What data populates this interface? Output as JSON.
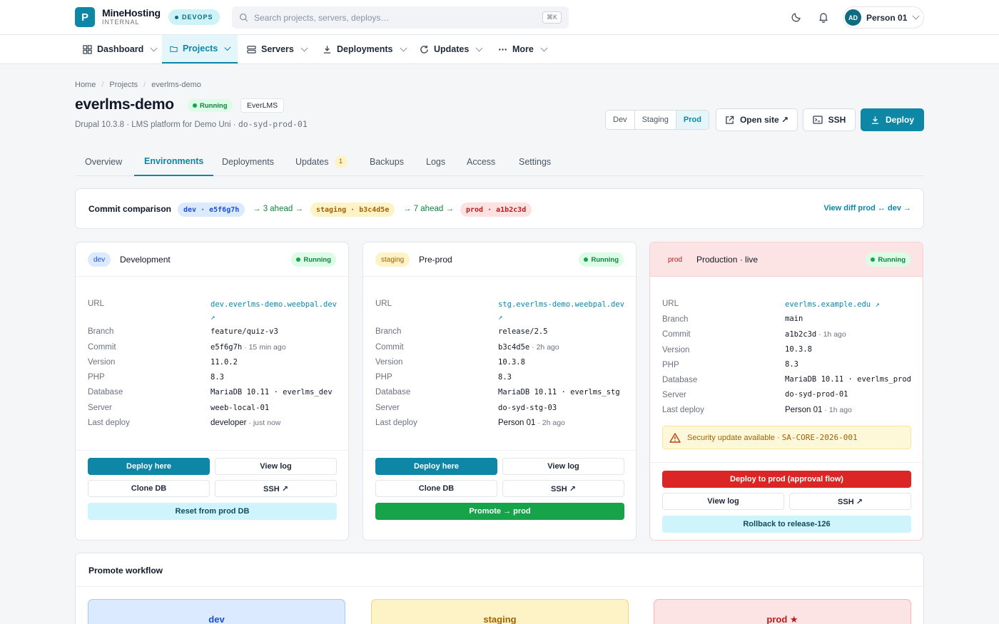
{
  "header": {
    "logo_letter": "P",
    "brand_name": "MineHosting",
    "brand_sub": "INTERNAL",
    "env_badge": "DEVOPS",
    "search_placeholder": "Search projects, servers, deploys…",
    "search_shortcut": "⌘K",
    "user_initials": "AD",
    "user_name": "Person 01"
  },
  "nav": {
    "items": [
      {
        "label": "Dashboard",
        "icon": "dashboard-icon"
      },
      {
        "label": "Projects",
        "icon": "folder-icon",
        "active": true
      },
      {
        "label": "Servers",
        "icon": "server-icon"
      },
      {
        "label": "Deployments",
        "icon": "download-icon"
      },
      {
        "label": "Updates",
        "icon": "refresh-icon"
      },
      {
        "label": "More",
        "icon": "more-icon"
      }
    ]
  },
  "breadcrumb": [
    "Home",
    "Projects",
    "everlms-demo"
  ],
  "project": {
    "title": "everlms-demo",
    "status": "Running",
    "tag": "EverLMS",
    "subtitle_plain": "Drupal 10.3.8 · LMS platform for Demo Uni · ",
    "subtitle_server": "do-syd-prod-01"
  },
  "env_switch": [
    "Dev",
    "Staging",
    "Prod"
  ],
  "actions": {
    "open_site": "Open site ↗",
    "ssh": "SSH",
    "deploy": "Deploy"
  },
  "tabs": [
    {
      "label": "Overview"
    },
    {
      "label": "Environments",
      "active": true
    },
    {
      "label": "Deployments"
    },
    {
      "label": "Updates",
      "badge": "1"
    },
    {
      "label": "Backups"
    },
    {
      "label": "Logs"
    },
    {
      "label": "Access"
    },
    {
      "label": "Settings"
    }
  ],
  "commit_comparison": {
    "title": "Commit comparison",
    "dev": "dev · e5f6g7h",
    "dev_to_staging": "→ 3 ahead →",
    "staging": "staging · b3c4d5e",
    "staging_to_prod": "→ 7 ahead →",
    "prod": "prod · a1b2c3d",
    "link": "View diff prod ↔ dev →"
  },
  "environments": {
    "dev": {
      "chip": "dev",
      "name": "Development",
      "status": "Running",
      "labels": [
        "URL",
        "Branch",
        "Commit",
        "Version",
        "PHP",
        "Database",
        "Server",
        "Last deploy"
      ],
      "url": "dev.everlms-demo.weebpal.dev ↗",
      "branch": "feature/quiz-v3",
      "commit": "e5f6g7h",
      "commit_age": " · 15 min ago",
      "version": "11.0.2",
      "php": "8.3",
      "database": "MariaDB 10.11 · everlms_dev",
      "server": "weeb-local-01",
      "last_deploy_by": "developer",
      "last_deploy_age": " · just now",
      "buttons": {
        "deploy": "Deploy here",
        "view_log": "View log",
        "clone_db": "Clone DB",
        "ssh": "SSH ↗",
        "reset": "Reset from prod DB"
      }
    },
    "staging": {
      "chip": "staging",
      "name": "Pre-prod",
      "status": "Running",
      "labels": [
        "URL",
        "Branch",
        "Commit",
        "Version",
        "PHP",
        "Database",
        "Server",
        "Last deploy"
      ],
      "url": "stg.everlms-demo.weebpal.dev ↗",
      "branch": "release/2.5",
      "commit": "b3c4d5e",
      "commit_age": " · 2h ago",
      "version": "10.3.8",
      "php": "8.3",
      "database": "MariaDB 10.11 · everlms_stg",
      "server": "do-syd-stg-03",
      "last_deploy_by": "Person 01",
      "last_deploy_age": " · 2h ago",
      "buttons": {
        "deploy": "Deploy here",
        "view_log": "View log",
        "clone_db": "Clone DB",
        "ssh": "SSH ↗",
        "promote": "Promote → prod"
      }
    },
    "prod": {
      "chip": "prod",
      "name": "Production · live",
      "status": "Running",
      "labels": [
        "URL",
        "Branch",
        "Commit",
        "Version",
        "PHP",
        "Database",
        "Server",
        "Last deploy"
      ],
      "url": "everlms.example.edu ↗",
      "branch": "main",
      "commit": "a1b2c3d",
      "commit_age": " · 1h ago",
      "version": "10.3.8",
      "php": "8.3",
      "database": "MariaDB 10.11 · everlms_prod",
      "server": "do-syd-prod-01",
      "last_deploy_by": "Person 01",
      "last_deploy_age": " · 1h ago",
      "warning_text": "Security update available · ",
      "warning_code": "SA-CORE-2026-001",
      "buttons": {
        "deploy": "Deploy to prod (approval flow)",
        "view_log": "View log",
        "ssh": "SSH ↗",
        "rollback": "Rollback to release-126"
      }
    }
  },
  "workflow": {
    "title": "Promote workflow",
    "stages": [
      "dev",
      "staging",
      "prod ★"
    ]
  },
  "colors": {
    "accent": "#0e86a6",
    "success": "#16a34a",
    "danger": "#dc2626",
    "warning": "#a16207"
  }
}
